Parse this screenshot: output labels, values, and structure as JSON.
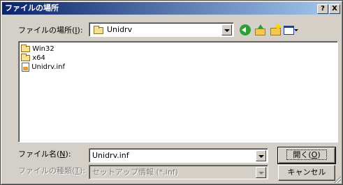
{
  "window": {
    "title": "ファイルの場所",
    "help_label": "?",
    "close_label": "X"
  },
  "location": {
    "label": "ファイルの場所(",
    "accel": "I",
    "label_end": "):",
    "value": "Unidrv"
  },
  "toolbar": {
    "icons": [
      "back-icon",
      "up-folder-icon",
      "new-folder-icon",
      "view-menu-icon"
    ]
  },
  "file_list": {
    "items": [
      {
        "name": "Win32",
        "icon": "folder-icon"
      },
      {
        "name": "x64",
        "icon": "folder-icon"
      },
      {
        "name": "Unidrv.inf",
        "icon": "setup-file-icon"
      }
    ]
  },
  "filename": {
    "label": "ファイル名(",
    "accel": "N",
    "label_end": "):",
    "value": "Unidrv.inf"
  },
  "filetype": {
    "label": "ファイルの種類(",
    "accel": "T",
    "label_end": "):",
    "value": "セットアップ情報 (*.inf)"
  },
  "buttons": {
    "open_label": "開く(",
    "open_accel": "O",
    "open_end": ")",
    "cancel_label": "キャンセル"
  }
}
